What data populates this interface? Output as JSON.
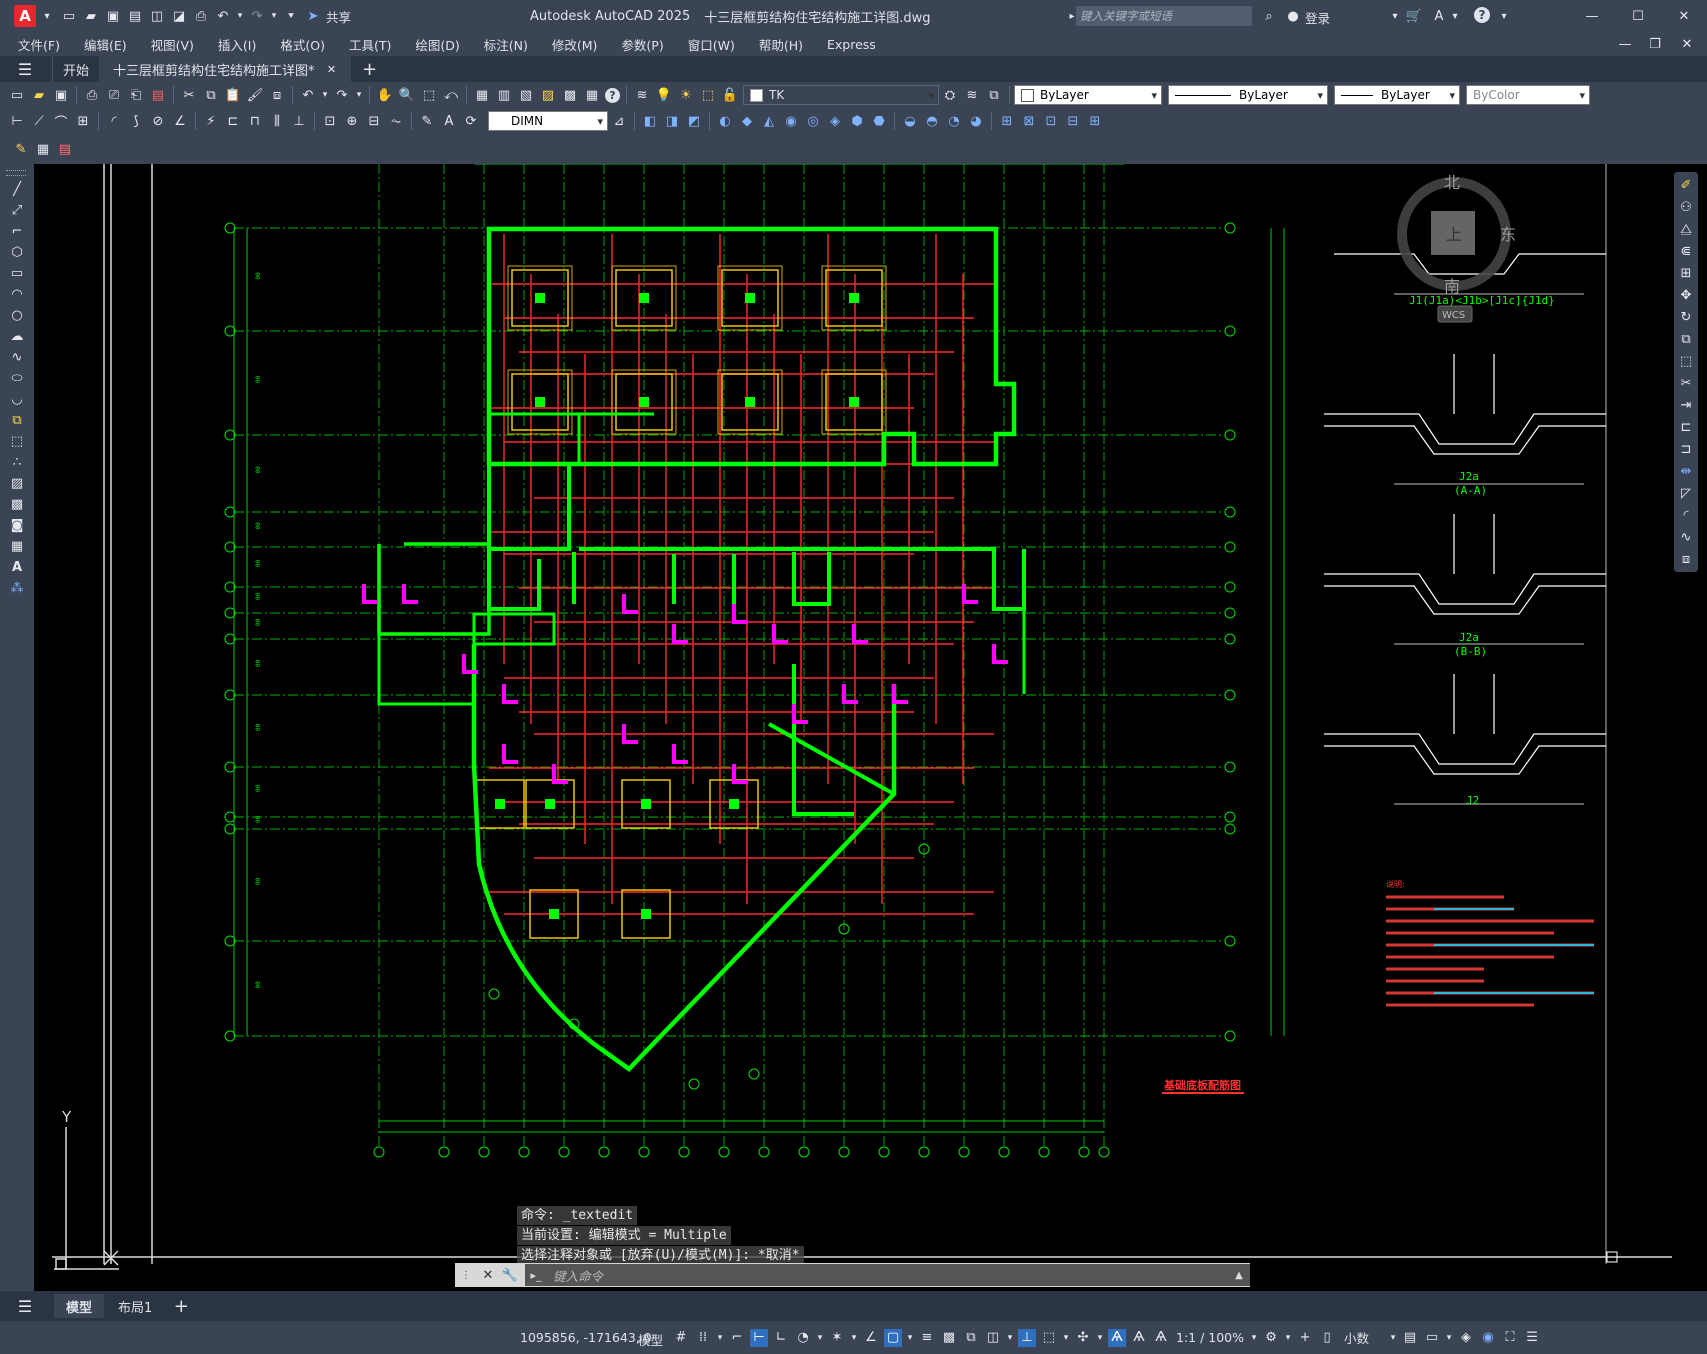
{
  "window": {
    "app_title": "Autodesk AutoCAD 2025",
    "file_title": "十三层框剪结构住宅结构施工详图.dwg",
    "share_label": "共享",
    "search_placeholder": "键入关键字或短语",
    "signin_label": "登录",
    "app_badge": "A"
  },
  "menu": [
    "文件(F)",
    "编辑(E)",
    "视图(V)",
    "插入(I)",
    "格式(O)",
    "工具(T)",
    "绘图(D)",
    "标注(N)",
    "修改(M)",
    "参数(P)",
    "窗口(W)",
    "帮助(H)",
    "Express"
  ],
  "tabs": [
    {
      "label": "开始"
    },
    {
      "label": "十三层框剪结构住宅结构施工详图*"
    }
  ],
  "toolbar": {
    "layer_name": "TK",
    "color": "ByLayer",
    "linetype": "ByLayer",
    "lineweight": "ByLayer",
    "plotstyle": "ByColor",
    "dimstyle": "DIMN"
  },
  "viewcube": {
    "north": "北",
    "east": "东",
    "south": "南",
    "top": "上",
    "wcs": "WCS"
  },
  "drawing": {
    "plan_title": "基础底板配筋图",
    "detail_titles": [
      "J1(J1a)<J1b>[J1c]{J1d}",
      "J2a\n(A-A)",
      "J2a\n(B-B)",
      "J2"
    ],
    "notes_heading": "说明:",
    "axis_ucs_y": "Y"
  },
  "command": {
    "history": [
      "命令: _textedit",
      "当前设置: 编辑模式 = Multiple",
      "选择注释对象或 [放弃(U)/模式(M)]: *取消*"
    ],
    "placeholder": "键入命令"
  },
  "layouts": {
    "model": "模型",
    "layout1": "布局1"
  },
  "status": {
    "coords": "1095856, -171643, 0",
    "model_label": "模型",
    "scale": "1:1 / 100%",
    "units": "小数"
  },
  "colors": {
    "wall": "#00ff00",
    "rebar": "#ff2a2a",
    "column": "#ff00ff",
    "footing": "#ffd400",
    "grid": "#00c800",
    "ui_bg": "#3a4455",
    "ui_dark": "#2b3442"
  }
}
